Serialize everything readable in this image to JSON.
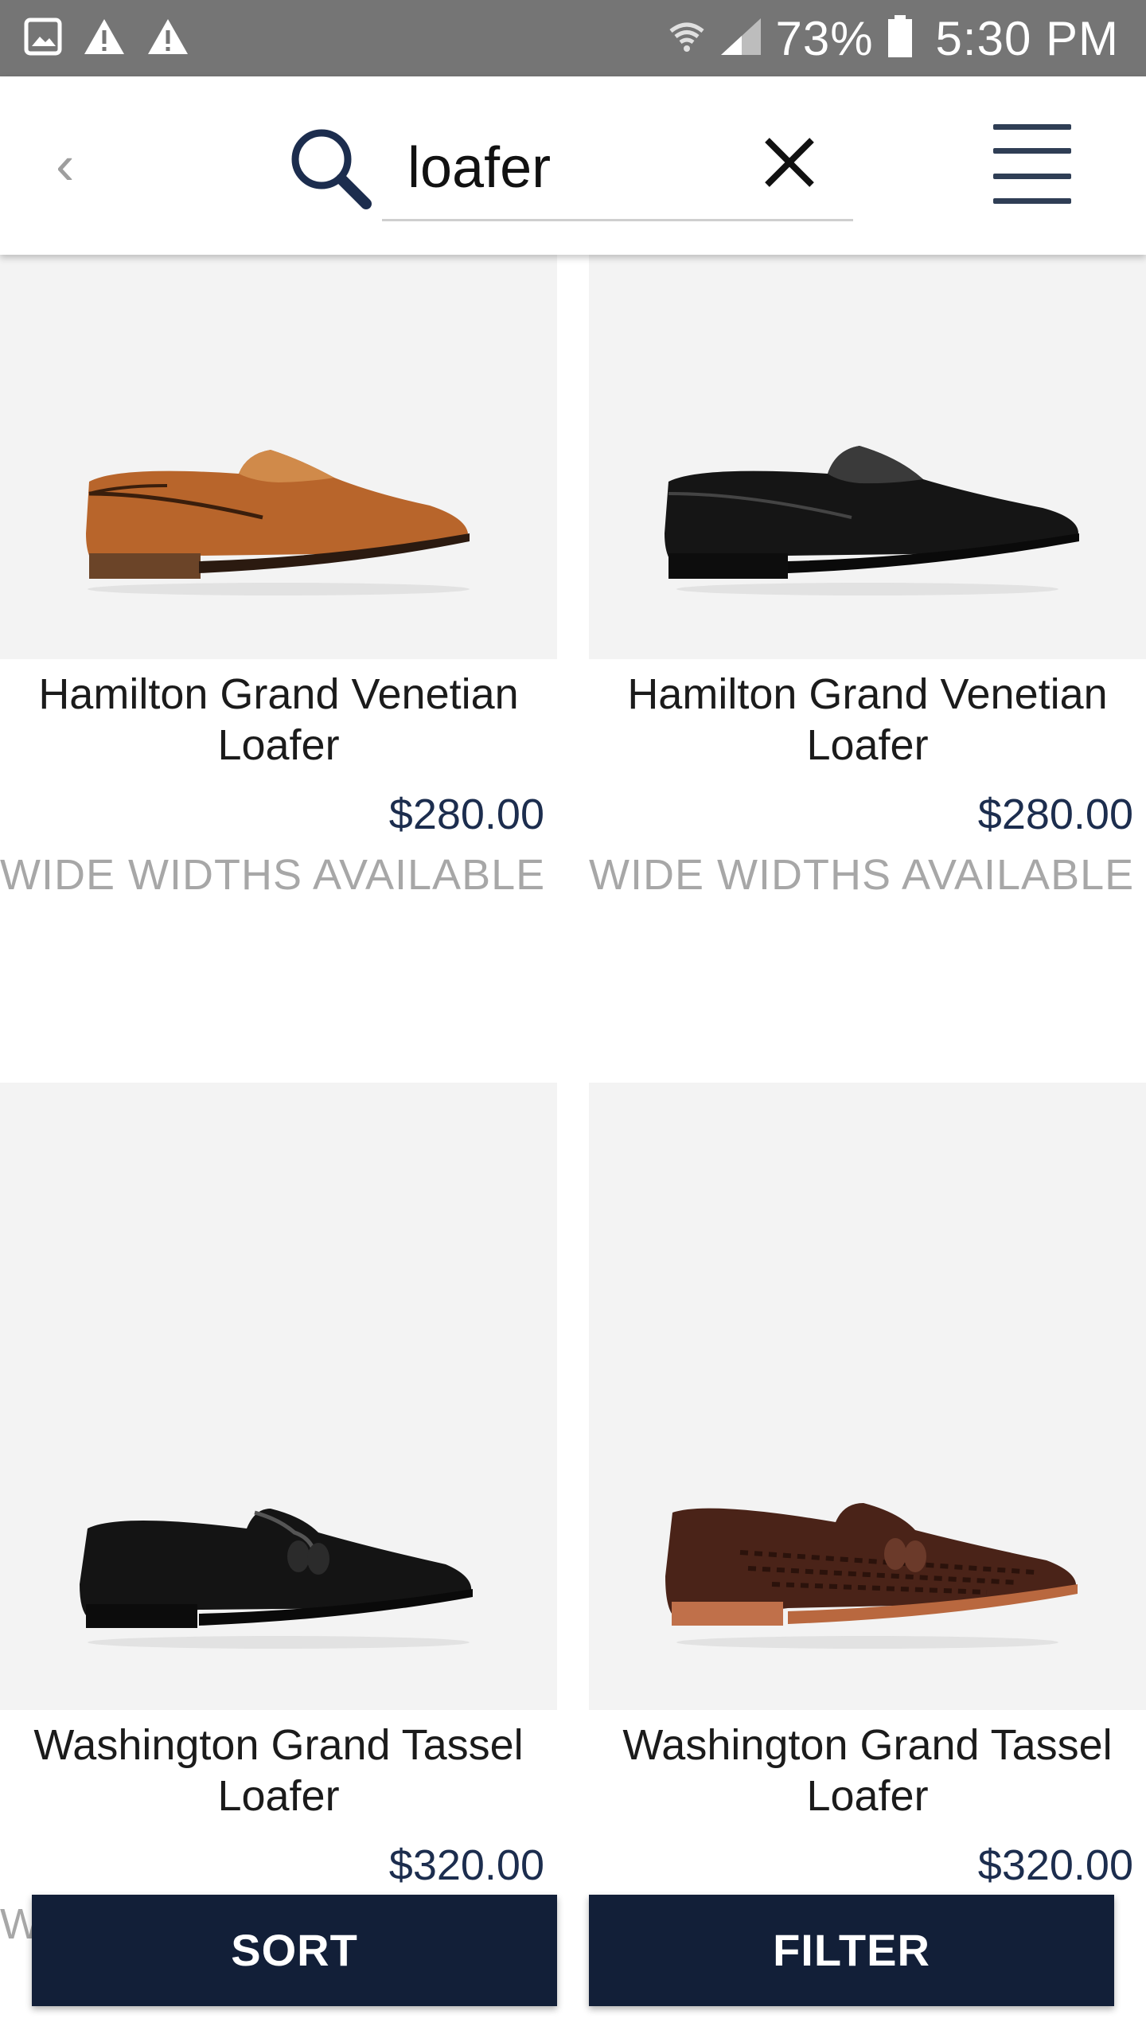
{
  "status_bar": {
    "battery": "73%",
    "time": "5:30 PM",
    "left_icons": [
      "gallery-notification-icon",
      "warning-icon",
      "warning-icon"
    ],
    "right_icons": [
      "wifi-icon",
      "signal-icon",
      "battery-icon"
    ]
  },
  "header": {
    "back_label": "‹",
    "search_value": "loafer",
    "clear_label": "✕"
  },
  "products": [
    {
      "name": "Hamilton Grand Venetian Loafer",
      "price": "$280.00",
      "note": "WIDE WIDTHS AVAILABLE",
      "color": "tan"
    },
    {
      "name": "Hamilton Grand Venetian Loafer",
      "price": "$280.00",
      "note": "WIDE WIDTHS AVAILABLE",
      "color": "black"
    },
    {
      "name": "Washington Grand Tassel Loafer",
      "price": "$320.00",
      "note": "",
      "color": "black"
    },
    {
      "name": "Washington Grand Tassel Loafer",
      "price": "$320.00",
      "note": "",
      "color": "brown"
    }
  ],
  "bottom_bar": {
    "sort_label": "SORT",
    "filter_label": "FILTER",
    "peek_text": "W"
  },
  "colors": {
    "status_bar": "#757575",
    "navy": "#121f38",
    "price": "#1c2d4e",
    "image_bg": "#f3f3f3"
  }
}
